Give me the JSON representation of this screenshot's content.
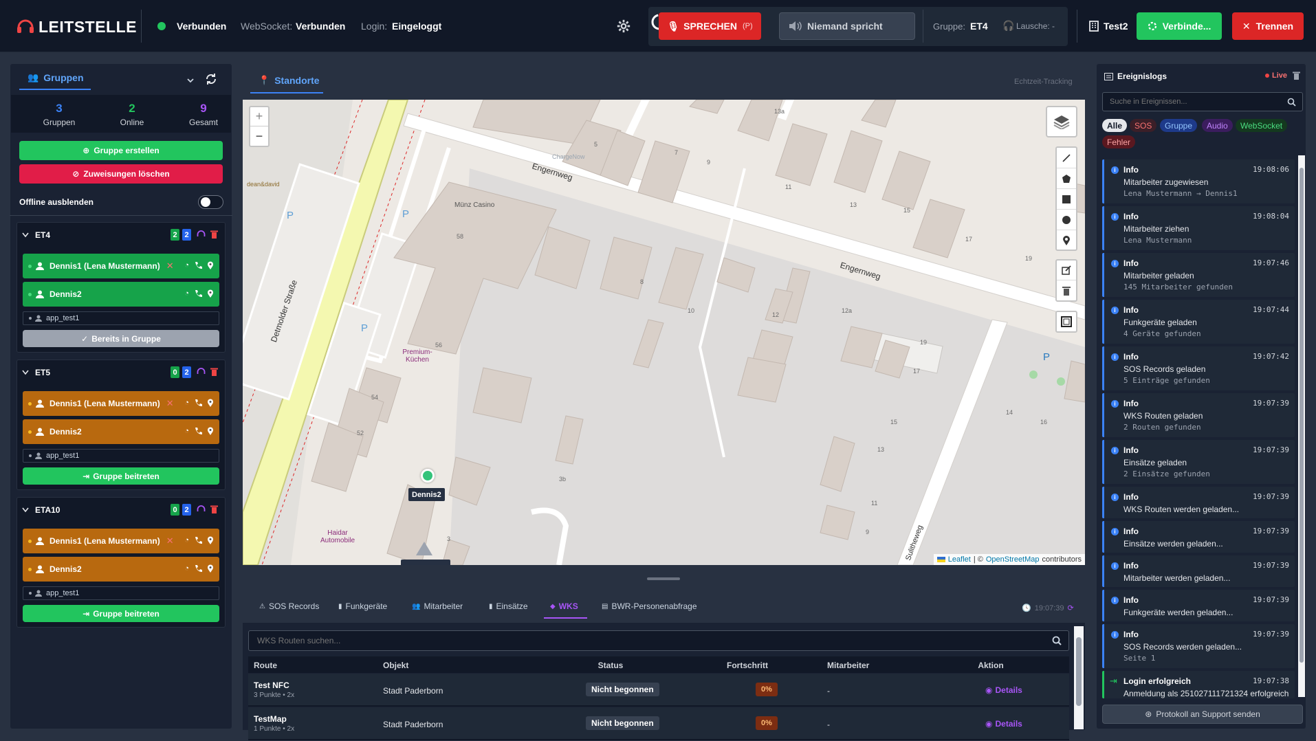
{
  "header": {
    "app_title": "LEITSTELLE",
    "conn_status": "Verbunden",
    "ws_label": "WebSocket:",
    "ws_value": "Verbunden",
    "login_label": "Login:",
    "login_value": "Eingeloggt",
    "speak_label": "SPRECHEN",
    "speak_key": "(P)",
    "speaking_label": "Niemand spricht",
    "group_label": "Gruppe:",
    "group_value": "ET4",
    "listen_label": "Lausche:",
    "listen_value": "-",
    "station": "Test2",
    "connect_label": "Verbinde...",
    "disconnect_label": "Trennen"
  },
  "sidebar": {
    "tab_label": "Gruppen",
    "stats": [
      {
        "value": "3",
        "label": "Gruppen",
        "color": "#3b82f6"
      },
      {
        "value": "2",
        "label": "Online",
        "color": "#22c55e"
      },
      {
        "value": "9",
        "label": "Gesamt",
        "color": "#a855f7"
      }
    ],
    "create_label": "Gruppe erstellen",
    "clear_label": "Zuweisungen löschen",
    "offline_label": "Offline ausblenden",
    "groups": [
      {
        "name": "ET4",
        "badge_a": "2",
        "badge_b": "2",
        "color": "green",
        "members": [
          "Dennis1 (Lena Mustermann)",
          "Dennis2"
        ],
        "app_user": "app_test1",
        "action": "Bereits in Gruppe",
        "action_disabled": true
      },
      {
        "name": "ET5",
        "badge_a": "0",
        "badge_b": "2",
        "color": "orange",
        "members": [
          "Dennis1 (Lena Mustermann)",
          "Dennis2"
        ],
        "app_user": "app_test1",
        "action": "Gruppe beitreten",
        "action_disabled": false
      },
      {
        "name": "ETA10",
        "badge_a": "0",
        "badge_b": "2",
        "color": "orange",
        "members": [
          "Dennis1 (Lena Mustermann)",
          "Dennis2"
        ],
        "app_user": "app_test1",
        "action": "Gruppe beitreten",
        "action_disabled": false
      }
    ]
  },
  "map": {
    "tab_label": "Standorte",
    "tracking_label": "Echtzeit-Tracking",
    "marker_label": "Dennis2",
    "attribution_leaflet": "Leaflet",
    "attribution_sep": "| ©",
    "attribution_osm": "OpenStreetMap",
    "attribution_tail": "contributors",
    "labels": {
      "street1": "Engernweg",
      "street2": "Engernweg",
      "street3": "Detmolder Straße",
      "street4": "Sulitheweg",
      "poi1": "Münz Casino",
      "poi2": "Premium-",
      "poi2b": "Küchen",
      "poi3": "Haidar",
      "poi3b": "Automobile",
      "poi4": "dean&david",
      "poi5": "ChargeNow"
    },
    "houses": [
      "13a",
      "5",
      "7",
      "9",
      "11",
      "13",
      "15",
      "17",
      "19",
      "58",
      "8",
      "10",
      "12",
      "12a",
      "19",
      "17",
      "15",
      "13",
      "14",
      "16",
      "56",
      "54",
      "52",
      "3b",
      "3",
      "11",
      "9",
      "P",
      "P",
      "P",
      "P"
    ]
  },
  "bottom": {
    "tabs": [
      "SOS Records",
      "Funkgeräte",
      "Mitarbeiter",
      "Einsätze",
      "WKS",
      "BWR-Personenabfrage"
    ],
    "active_tab": "WKS",
    "timestamp": "19:07:39",
    "search_placeholder": "WKS Routen suchen...",
    "columns": [
      "Route",
      "Objekt",
      "Status",
      "Fortschritt",
      "Mitarbeiter",
      "Aktion"
    ],
    "rows": [
      {
        "route": "Test NFC",
        "sub": "3 Punkte • 2x",
        "object": "Stadt Paderborn",
        "status": "Nicht begonnen",
        "progress": "0%",
        "employee": "-",
        "action": "Details"
      },
      {
        "route": "TestMap",
        "sub": "1 Punkte • 2x",
        "object": "Stadt Paderborn",
        "status": "Nicht begonnen",
        "progress": "0%",
        "employee": "-",
        "action": "Details"
      }
    ]
  },
  "events": {
    "title": "Ereignislogs",
    "live": "Live",
    "search_placeholder": "Suche in Ereignissen...",
    "filters": [
      {
        "label": "Alle",
        "bg": "#e5e7eb",
        "fg": "#111827"
      },
      {
        "label": "SOS",
        "bg": "#3b1f28",
        "fg": "#f87171"
      },
      {
        "label": "Gruppe",
        "bg": "#1e3a8a",
        "fg": "#93c5fd"
      },
      {
        "label": "Audio",
        "bg": "#3b1d5e",
        "fg": "#c084fc"
      },
      {
        "label": "WebSocket",
        "bg": "#14391f",
        "fg": "#4ade80"
      },
      {
        "label": "Fehler",
        "bg": "#5a1820",
        "fg": "#fca5a5"
      }
    ],
    "entries": [
      {
        "type": "Info",
        "time": "19:08:06",
        "msg": "Mitarbeiter zugewiesen",
        "sub": "Lena Mustermann → Dennis1"
      },
      {
        "type": "Info",
        "time": "19:08:04",
        "msg": "Mitarbeiter ziehen",
        "sub": "Lena Mustermann"
      },
      {
        "type": "Info",
        "time": "19:07:46",
        "msg": "Mitarbeiter geladen",
        "sub": "145 Mitarbeiter gefunden"
      },
      {
        "type": "Info",
        "time": "19:07:44",
        "msg": "Funkgeräte geladen",
        "sub": "4 Geräte gefunden"
      },
      {
        "type": "Info",
        "time": "19:07:42",
        "msg": "SOS Records geladen",
        "sub": "5 Einträge gefunden"
      },
      {
        "type": "Info",
        "time": "19:07:39",
        "msg": "WKS Routen geladen",
        "sub": "2 Routen gefunden"
      },
      {
        "type": "Info",
        "time": "19:07:39",
        "msg": "Einsätze geladen",
        "sub": "2 Einsätze gefunden"
      },
      {
        "type": "Info",
        "time": "19:07:39",
        "msg": "WKS Routen werden geladen...",
        "sub": ""
      },
      {
        "type": "Info",
        "time": "19:07:39",
        "msg": "Einsätze werden geladen...",
        "sub": ""
      },
      {
        "type": "Info",
        "time": "19:07:39",
        "msg": "Mitarbeiter werden geladen...",
        "sub": ""
      },
      {
        "type": "Info",
        "time": "19:07:39",
        "msg": "Funkgeräte werden geladen...",
        "sub": ""
      },
      {
        "type": "Info",
        "time": "19:07:39",
        "msg": "SOS Records werden geladen...",
        "sub": "Seite 1"
      },
      {
        "type": "Login erfolgreich",
        "time": "19:07:38",
        "msg": "Anmeldung als 251027111721324 erfolgreich",
        "sub": ""
      }
    ],
    "support_label": "Protokoll an Support senden"
  }
}
